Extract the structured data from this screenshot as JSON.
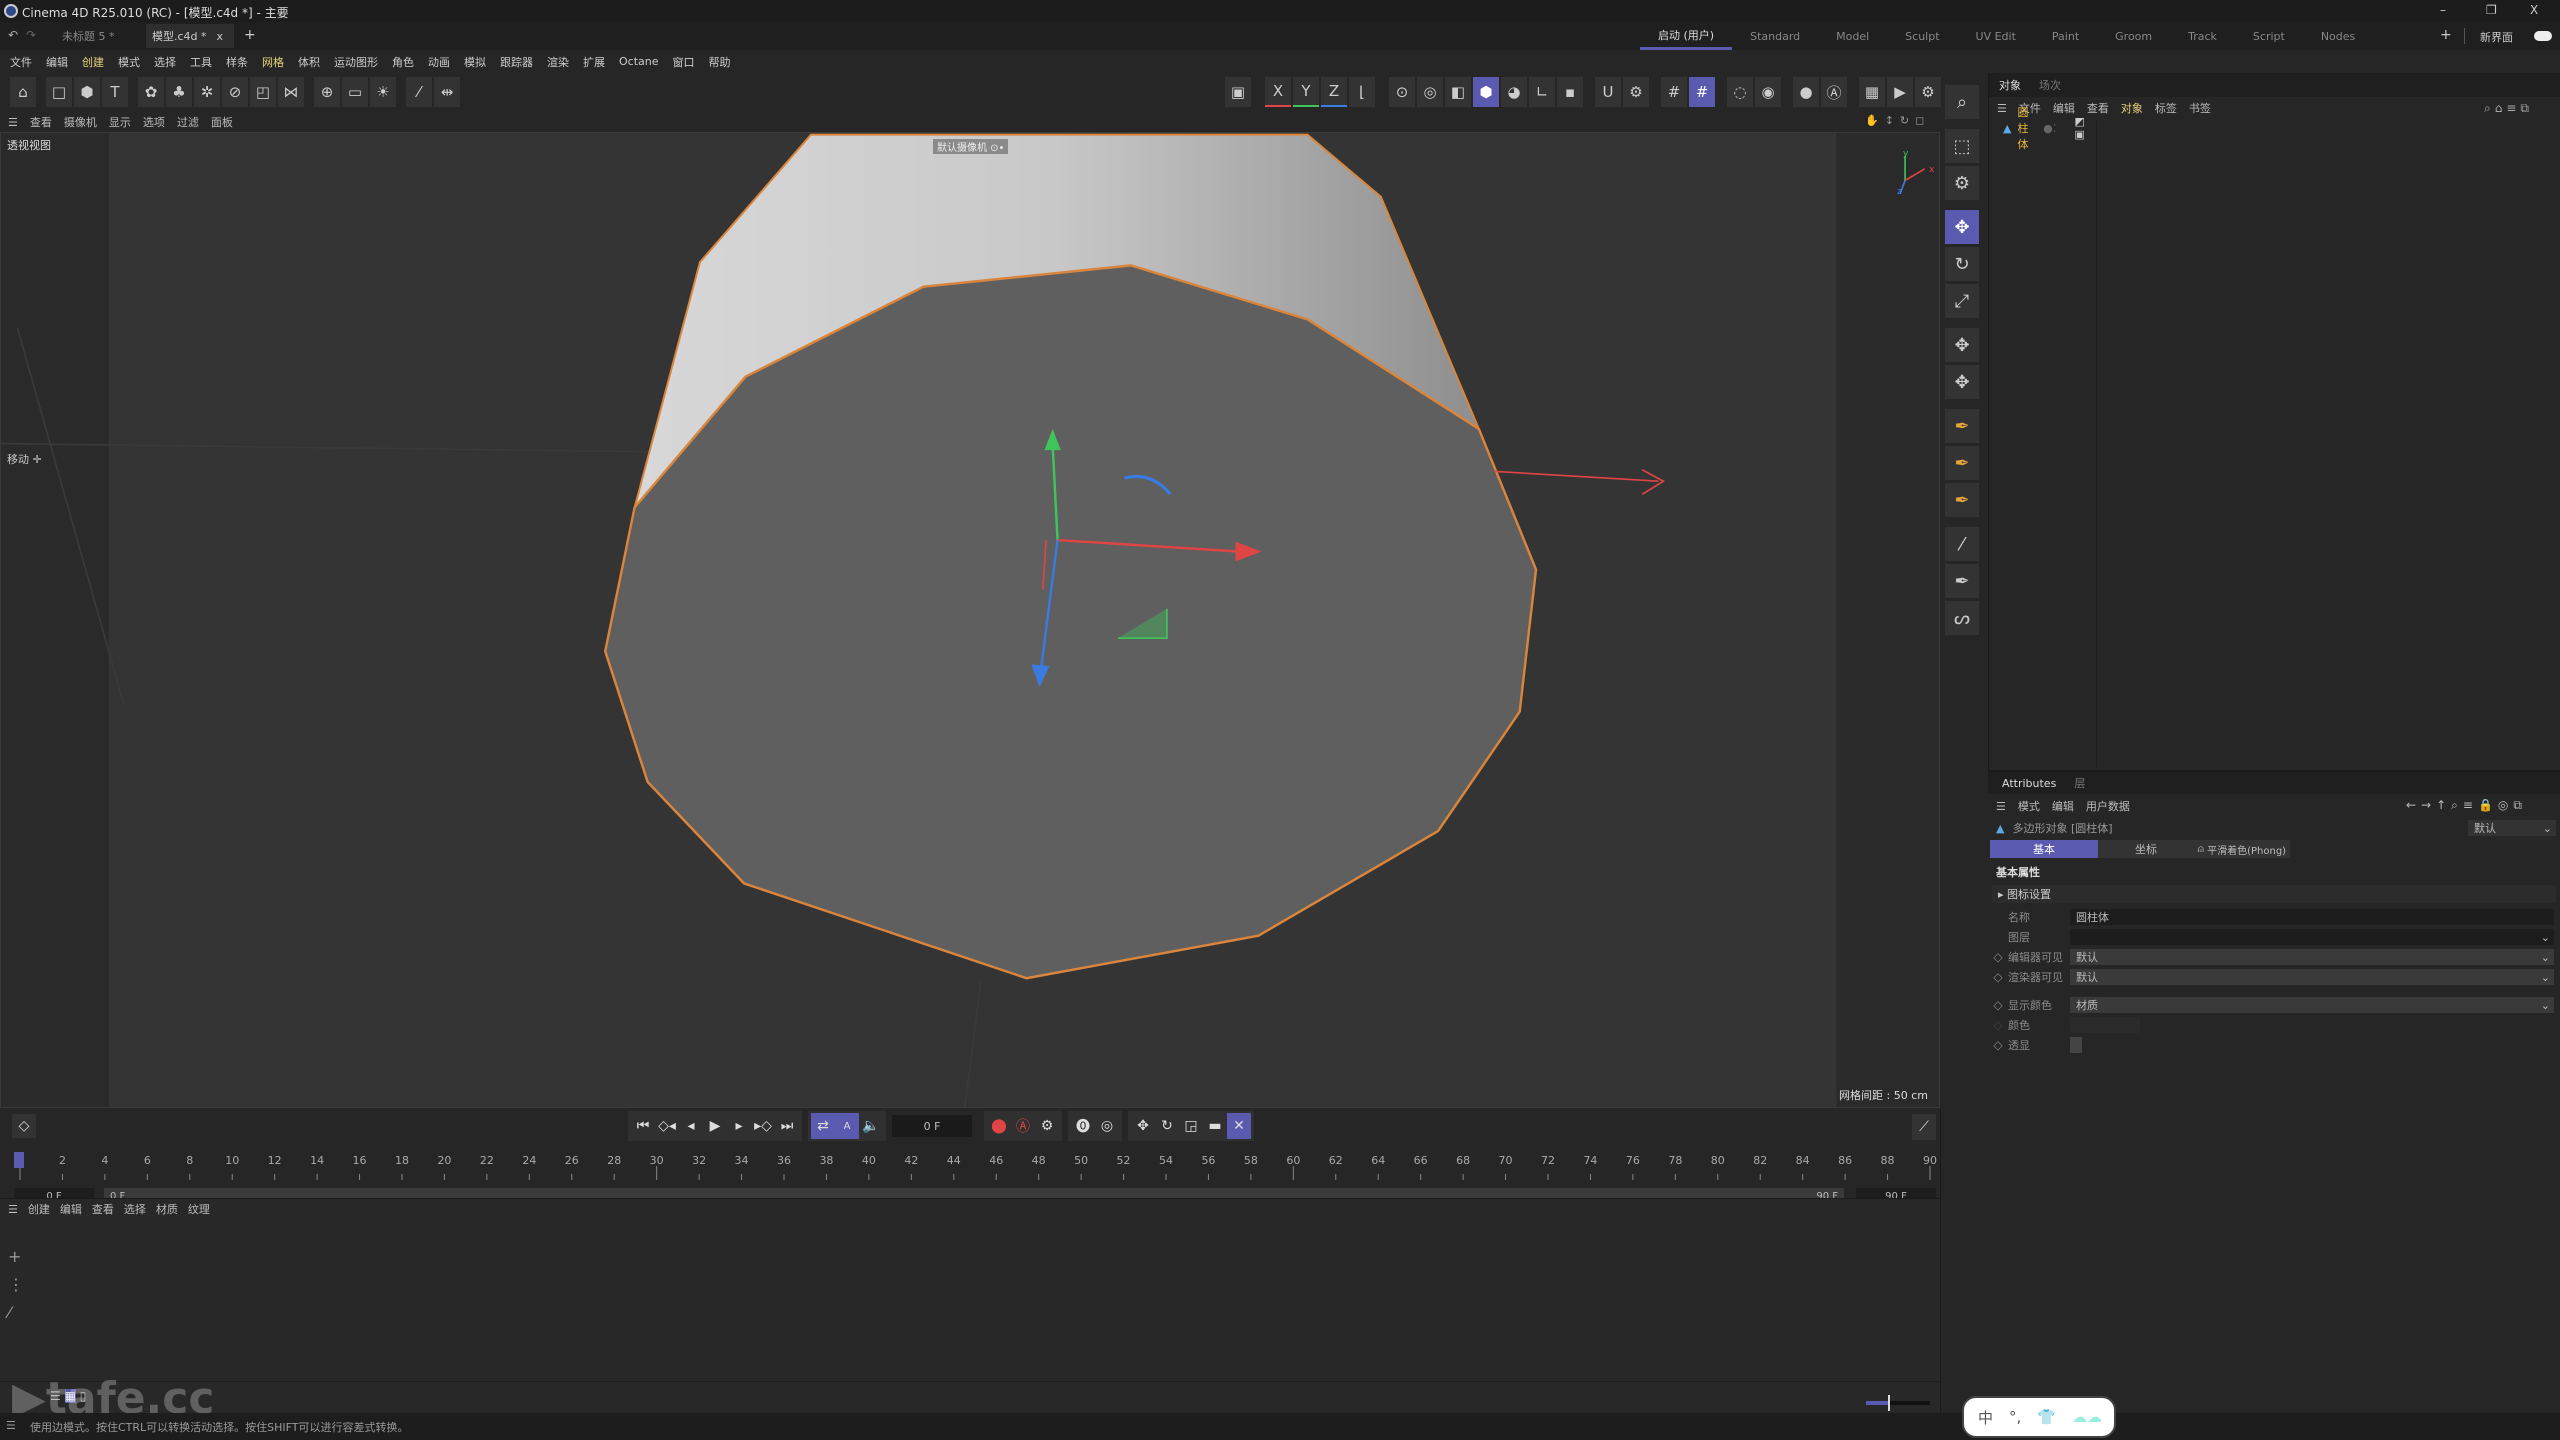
{
  "window": {
    "title": "Cinema 4D R25.010 (RC) - [模型.c4d *] - 主要",
    "minimize": "–",
    "restore": "❐",
    "close": "X"
  },
  "doc_tabs": [
    {
      "label": "未标题 5 *",
      "active": false
    },
    {
      "label": "模型.c4d *",
      "active": true
    }
  ],
  "doc_tab_close": "x",
  "doc_tab_add": "+",
  "layouts": [
    "启动 (用户)",
    "Standard",
    "Model",
    "Sculpt",
    "UV Edit",
    "Paint",
    "Groom",
    "Track",
    "Script",
    "Nodes"
  ],
  "layout_add": "+",
  "new_layout": "新界面",
  "menu": [
    "文件",
    "编辑",
    "创建",
    "模式",
    "选择",
    "工具",
    "样条",
    "网格",
    "体积",
    "运动图形",
    "角色",
    "动画",
    "模拟",
    "跟踪器",
    "渲染",
    "扩展",
    "Octane",
    "窗口",
    "帮助"
  ],
  "menu_highlight": [
    "创建",
    "网格"
  ],
  "toolbar_left": [
    [
      "model-mode",
      "⌂"
    ],
    [
      "cube",
      "□"
    ],
    [
      "cube-primitive",
      "⬢"
    ],
    [
      "text",
      "T"
    ],
    [
      "subdivision",
      "✿"
    ],
    [
      "cloner",
      "♣"
    ],
    [
      "effector",
      "✲"
    ],
    [
      "deformer",
      "⊘"
    ],
    [
      "spline-mask",
      "◰"
    ],
    [
      "field",
      "⋈"
    ],
    [
      "environment",
      "⊕"
    ],
    [
      "camera",
      "▭"
    ],
    [
      "light",
      "☀"
    ],
    [
      "pen-a",
      "⁄"
    ],
    [
      "pen-b",
      "⇹"
    ]
  ],
  "axis_labels": [
    "X",
    "Y",
    "Z"
  ],
  "toolbar_mid": [
    [
      "points-mode",
      "⊙"
    ],
    [
      "edges-mode",
      "◎"
    ],
    [
      "polygons-mode",
      "◧"
    ],
    [
      "polygon-object",
      "⬢"
    ],
    [
      "uv-mode",
      "◕"
    ],
    [
      "axis-mode",
      "∟"
    ],
    [
      "workplane",
      "▪"
    ],
    [
      "magnet",
      "Ս"
    ],
    [
      "snap-settings",
      "⚙"
    ],
    [
      "grid",
      "#"
    ],
    [
      "snap",
      "#"
    ],
    [
      "isoline",
      "◌"
    ],
    [
      "solo",
      "◉"
    ],
    [
      "render-view",
      "●"
    ],
    [
      "render-active",
      "Ⓐ"
    ],
    [
      "render-settings",
      "▦"
    ],
    [
      "render-queue",
      "▶"
    ],
    [
      "render-more",
      "⚙"
    ]
  ],
  "viewport_menu": [
    "查看",
    "摄像机",
    "显示",
    "选项",
    "过滤",
    "面板"
  ],
  "viewport": {
    "view_name": "透视视图",
    "camera_label": "默认摄像机 ⊙•",
    "tool_label": "移动",
    "grid_spacing": "网格间距 : 50 cm",
    "axis_y": "y",
    "axis_x": "x",
    "axis_z": "z",
    "colors": {
      "edge": "#d9853b",
      "cap": "#5f5f5f",
      "x": "#e04545",
      "y": "#3fc45a",
      "z": "#3a7be0"
    }
  },
  "right_tools": [
    [
      "search",
      "⌕",
      false
    ],
    [
      "live-selection",
      "⬚",
      false
    ],
    [
      "selection-settings",
      "⚙",
      false
    ],
    [
      "move",
      "✥",
      true
    ],
    [
      "rotate",
      "↻",
      false
    ],
    [
      "scale",
      "⤢",
      false
    ],
    [
      "move-mode-a",
      "✥",
      false
    ],
    [
      "move-mode-b",
      "✥",
      false
    ],
    [
      "spline-pen",
      "✒",
      false
    ],
    [
      "spline-pen-point",
      "✒",
      false
    ],
    [
      "spline-pen-multi",
      "✒",
      false
    ],
    [
      "brush",
      "⁄",
      false
    ],
    [
      "pen-line",
      "✒",
      false
    ],
    [
      "sketch",
      "ᔕ",
      false
    ]
  ],
  "object_manager": {
    "tabs": [
      "对象",
      "场次"
    ],
    "menu": [
      "文件",
      "编辑",
      "查看",
      "对象",
      "标签",
      "书签"
    ],
    "menu_active": "对象",
    "objects": [
      {
        "name": "圆柱体"
      }
    ]
  },
  "attributes": {
    "tabs": [
      "Attributes",
      "层"
    ],
    "menu": [
      "模式",
      "编辑",
      "用户数据"
    ],
    "object_title": "多边形对象 [圆柱体]",
    "preset": "默认",
    "sub_tabs": [
      "基本",
      "坐标",
      "平滑着色(Phong)"
    ],
    "section": "基本属性",
    "group": "图标设置",
    "fields": [
      {
        "label": "名称",
        "value": "圆柱体"
      },
      {
        "label": "图层",
        "value": ""
      },
      {
        "label": "编辑器可见",
        "value": "默认"
      },
      {
        "label": "渲染器可见",
        "value": "默认"
      },
      {
        "label": "显示颜色",
        "value": "材质"
      },
      {
        "label": "颜色",
        "value": ""
      },
      {
        "label": "透显",
        "value": ""
      }
    ]
  },
  "timeline": {
    "current_frame": "0 F",
    "start_field": "0 F",
    "range_start": "0 F",
    "range_end": "90 F",
    "end_field": "90 F",
    "ticks_min": 0,
    "ticks_max": 90,
    "tick_step": 2,
    "accent": "#5a5bb0"
  },
  "material_menu": [
    "创建",
    "编辑",
    "查看",
    "选择",
    "材质",
    "纹理"
  ],
  "status": "使用边模式。按住CTRL可以转换活动选择。按住SHIFT可以进行容差式转换。",
  "ime": {
    "mode": "中",
    "punct": "°,"
  },
  "watermark": "tafe.cc"
}
